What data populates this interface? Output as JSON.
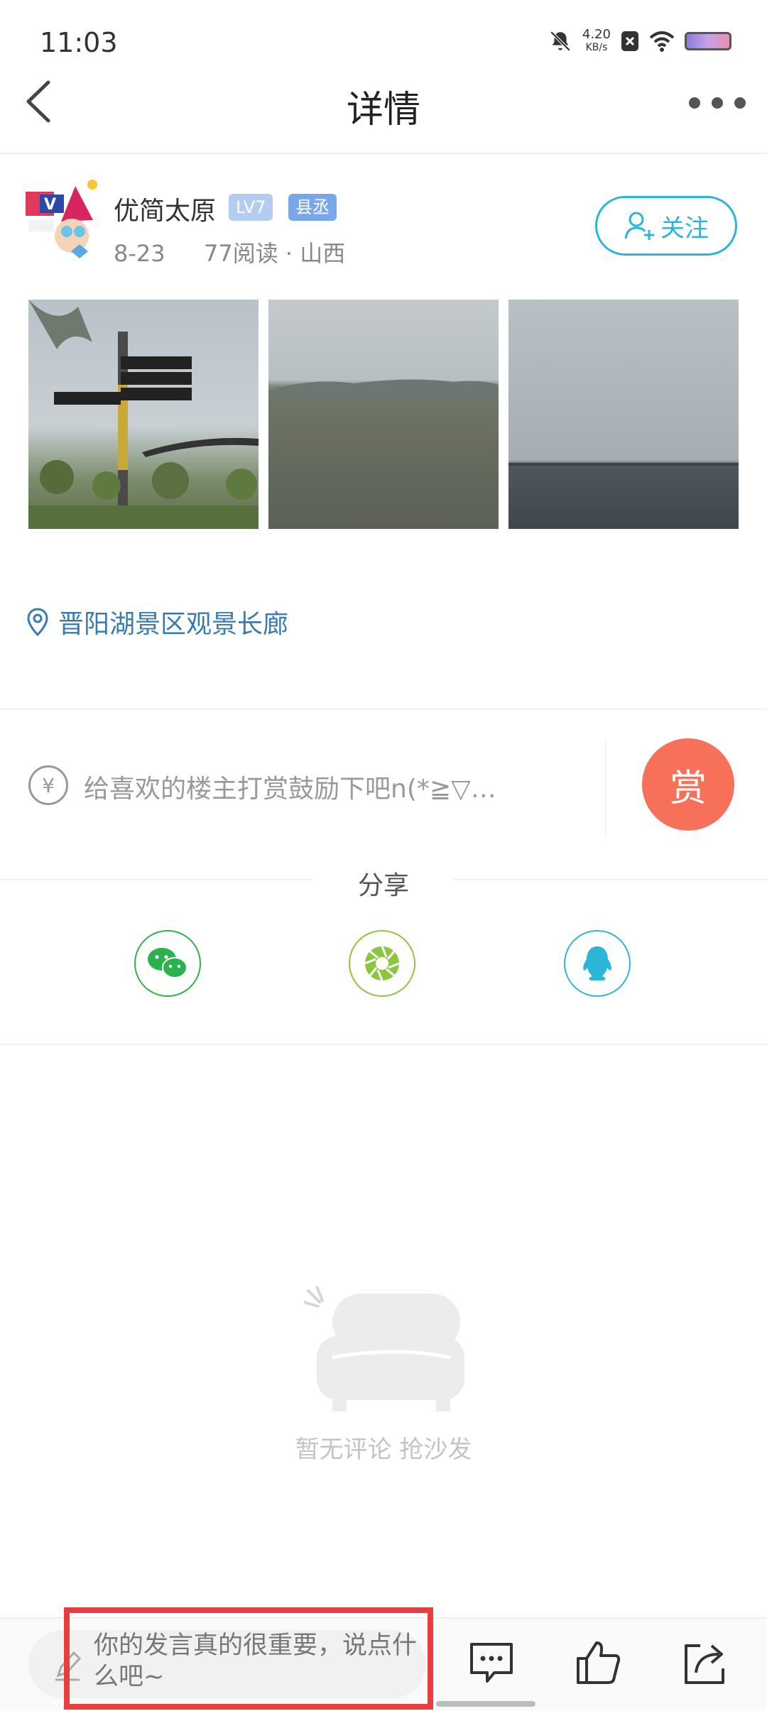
{
  "status_bar": {
    "time": "11:03",
    "net_speed_value": "4.20",
    "net_speed_unit": "KB/s"
  },
  "header": {
    "title": "详情"
  },
  "post": {
    "author_name": "优简太原",
    "level_badge": "LV7",
    "title_badge": "县丞",
    "date": "8-23",
    "read_location": "77阅读 · 山西",
    "follow_label": "关注",
    "location": "晋阳湖景区观景长廊"
  },
  "reward": {
    "placeholder": "给喜欢的楼主打赏鼓励下吧n(*≧▽…",
    "button_label": "赏",
    "currency_symbol": "¥"
  },
  "share": {
    "title": "分享"
  },
  "comments": {
    "empty_text": "暂无评论 抢沙发"
  },
  "bottom_bar": {
    "comment_placeholder": "你的发言真的很重要，说点什么吧~"
  },
  "colors": {
    "accent": "#2cb5d6",
    "reward": "#f7705a",
    "location": "#3a7bb0",
    "highlight": "#e5403f"
  }
}
